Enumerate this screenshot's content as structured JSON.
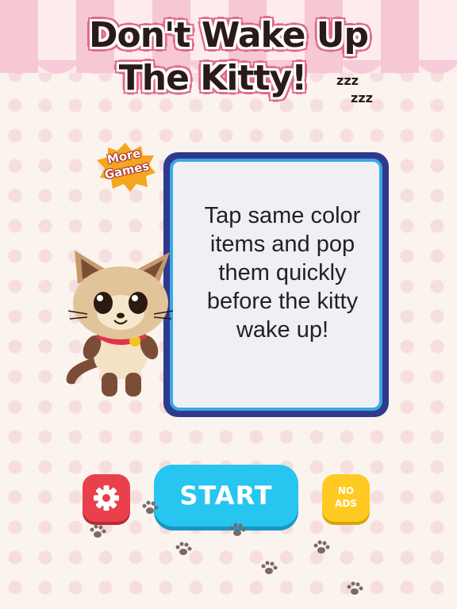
{
  "title": {
    "line1": "Don't Wake Up",
    "line2": "The Kitty!",
    "zzz": "zzz"
  },
  "more_games": {
    "line1": "More",
    "line2": "Games"
  },
  "instructions": {
    "text": "Tap same color items and pop them quickly before the kitty wake up!"
  },
  "buttons": {
    "start": "START",
    "no_ads_line1": "NO",
    "no_ads_line2": "ADS"
  },
  "colors": {
    "settings": "#e8414b",
    "start": "#26c6f0",
    "no_ads": "#ffca22",
    "card_border": "#2f3a8c"
  }
}
